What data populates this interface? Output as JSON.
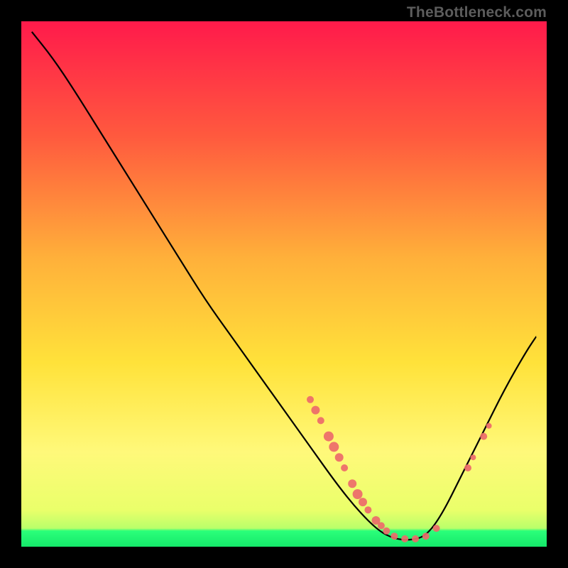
{
  "watermark": "TheBottleneck.com",
  "chart_data": {
    "type": "line",
    "xlim": [
      0,
      100
    ],
    "ylim": [
      0,
      100
    ],
    "title": "",
    "xlabel": "",
    "ylabel": "",
    "background_gradient": {
      "top": "#ff1a4b",
      "mid_upper": "#ff7a3a",
      "mid": "#ffd93a",
      "mid_lower": "#fff97a",
      "bottom_band": "#2bff7a"
    },
    "curve": [
      {
        "x": 2,
        "y": 98
      },
      {
        "x": 6,
        "y": 93
      },
      {
        "x": 10,
        "y": 87
      },
      {
        "x": 15,
        "y": 79
      },
      {
        "x": 20,
        "y": 71
      },
      {
        "x": 25,
        "y": 63
      },
      {
        "x": 30,
        "y": 55
      },
      {
        "x": 35,
        "y": 47
      },
      {
        "x": 40,
        "y": 40
      },
      {
        "x": 45,
        "y": 33
      },
      {
        "x": 50,
        "y": 26
      },
      {
        "x": 55,
        "y": 19
      },
      {
        "x": 60,
        "y": 12
      },
      {
        "x": 64,
        "y": 7
      },
      {
        "x": 68,
        "y": 3
      },
      {
        "x": 71,
        "y": 1.5
      },
      {
        "x": 74,
        "y": 1.2
      },
      {
        "x": 77,
        "y": 2
      },
      {
        "x": 80,
        "y": 6
      },
      {
        "x": 84,
        "y": 14
      },
      {
        "x": 88,
        "y": 22
      },
      {
        "x": 92,
        "y": 30
      },
      {
        "x": 96,
        "y": 37
      },
      {
        "x": 98,
        "y": 40
      }
    ],
    "markers": [
      {
        "x": 55,
        "y": 28,
        "r": 5
      },
      {
        "x": 56,
        "y": 26,
        "r": 6
      },
      {
        "x": 57,
        "y": 24,
        "r": 5
      },
      {
        "x": 58.5,
        "y": 21,
        "r": 7
      },
      {
        "x": 59.5,
        "y": 19,
        "r": 7
      },
      {
        "x": 60.5,
        "y": 17,
        "r": 6
      },
      {
        "x": 61.5,
        "y": 15,
        "r": 5
      },
      {
        "x": 63,
        "y": 12,
        "r": 6
      },
      {
        "x": 64,
        "y": 10,
        "r": 7
      },
      {
        "x": 65,
        "y": 8.5,
        "r": 6
      },
      {
        "x": 66,
        "y": 7,
        "r": 5
      },
      {
        "x": 67.5,
        "y": 5,
        "r": 6
      },
      {
        "x": 68.5,
        "y": 4,
        "r": 5
      },
      {
        "x": 69.5,
        "y": 3,
        "r": 5
      },
      {
        "x": 71,
        "y": 2,
        "r": 5
      },
      {
        "x": 73,
        "y": 1.5,
        "r": 5
      },
      {
        "x": 75,
        "y": 1.5,
        "r": 5
      },
      {
        "x": 77,
        "y": 2,
        "r": 5
      },
      {
        "x": 79,
        "y": 3.5,
        "r": 5
      },
      {
        "x": 85,
        "y": 15,
        "r": 5
      },
      {
        "x": 86,
        "y": 17,
        "r": 4
      },
      {
        "x": 88,
        "y": 21,
        "r": 5
      },
      {
        "x": 89,
        "y": 23,
        "r": 4
      }
    ]
  }
}
